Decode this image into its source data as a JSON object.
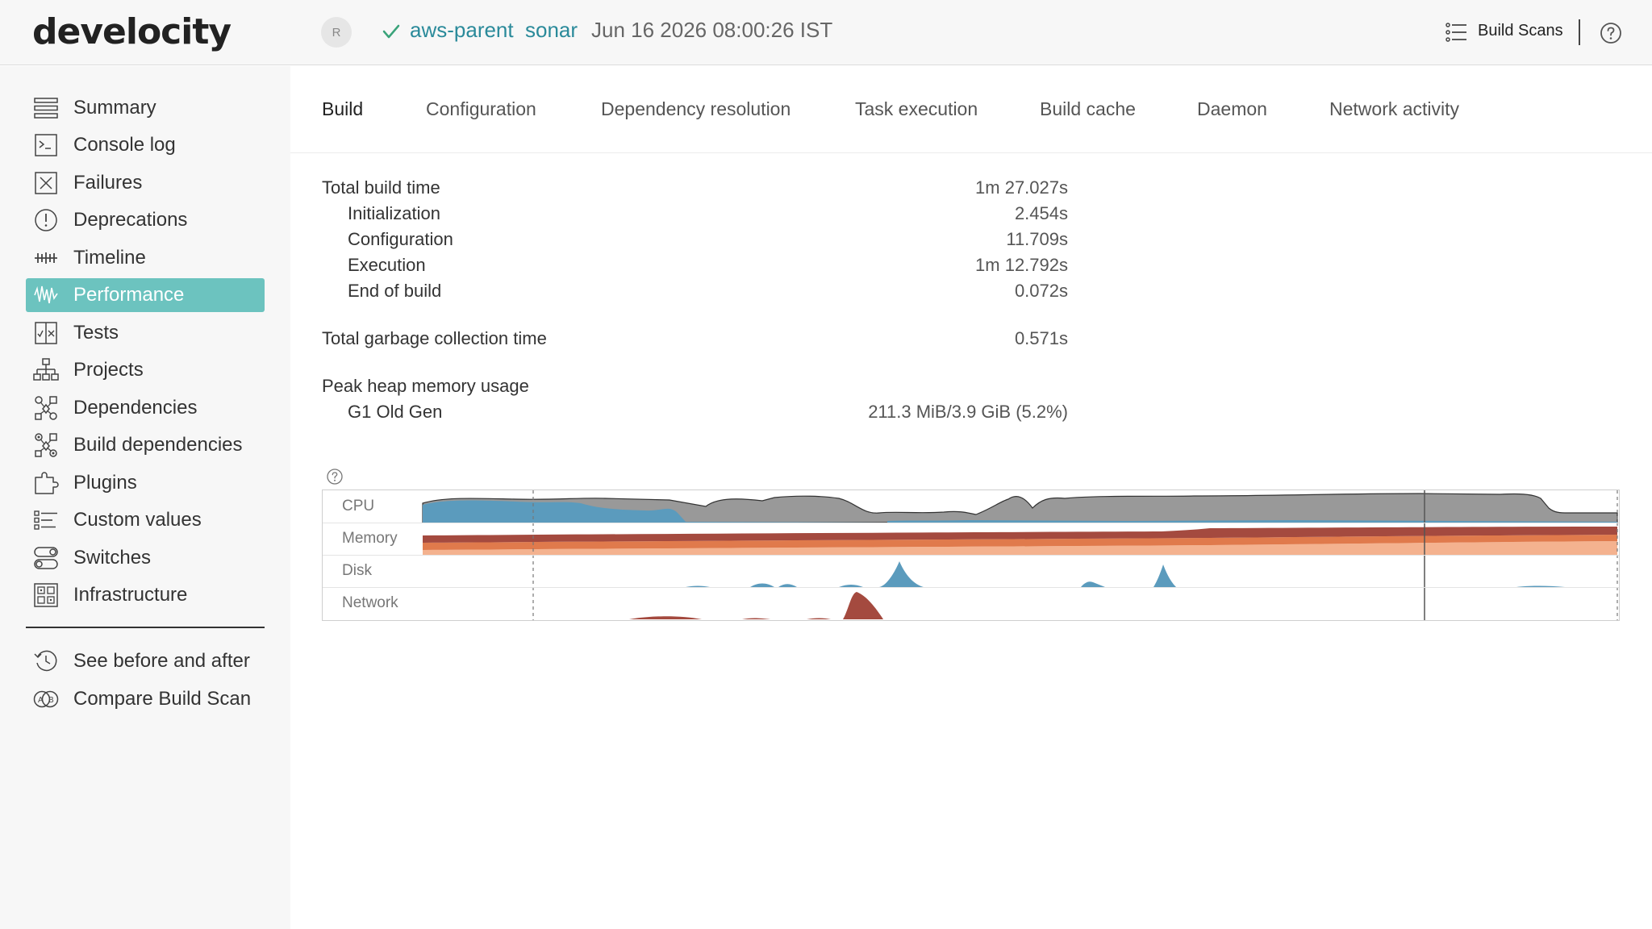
{
  "header": {
    "logo": "develocity",
    "avatar_initial": "R",
    "project": "aws-parent",
    "task": "sonar",
    "build_date": "Jun 16 2026 08:00:26 IST",
    "build_scans_label": "Build Scans"
  },
  "sidebar": {
    "items": [
      {
        "label": "Summary",
        "icon": "list-icon"
      },
      {
        "label": "Console log",
        "icon": "console-icon"
      },
      {
        "label": "Failures",
        "icon": "x-box-icon"
      },
      {
        "label": "Deprecations",
        "icon": "alert-circle-icon"
      },
      {
        "label": "Timeline",
        "icon": "timeline-icon"
      },
      {
        "label": "Performance",
        "icon": "waveform-icon"
      },
      {
        "label": "Tests",
        "icon": "tests-icon"
      },
      {
        "label": "Projects",
        "icon": "hierarchy-icon"
      },
      {
        "label": "Dependencies",
        "icon": "dependencies-icon"
      },
      {
        "label": "Build dependencies",
        "icon": "build-dependencies-icon"
      },
      {
        "label": "Plugins",
        "icon": "plugin-icon"
      },
      {
        "label": "Custom values",
        "icon": "custom-values-icon"
      },
      {
        "label": "Switches",
        "icon": "switches-icon"
      },
      {
        "label": "Infrastructure",
        "icon": "infrastructure-icon"
      }
    ],
    "active": "Performance",
    "secondary": [
      {
        "label": "See before and after",
        "icon": "history-icon"
      },
      {
        "label": "Compare Build Scan",
        "icon": "compare-icon"
      }
    ]
  },
  "tabs": [
    {
      "label": "Build"
    },
    {
      "label": "Configuration"
    },
    {
      "label": "Dependency resolution"
    },
    {
      "label": "Task execution"
    },
    {
      "label": "Build cache"
    },
    {
      "label": "Daemon"
    },
    {
      "label": "Network activity"
    }
  ],
  "active_tab": "Build",
  "metrics": {
    "total_build_time": {
      "label": "Total build time",
      "value": "1m 27.027s"
    },
    "initialization": {
      "label": "Initialization",
      "value": "2.454s"
    },
    "configuration": {
      "label": "Configuration",
      "value": "11.709s"
    },
    "execution": {
      "label": "Execution",
      "value": "1m 12.792s"
    },
    "end_of_build": {
      "label": "End of build",
      "value": "0.072s"
    },
    "gc_time": {
      "label": "Total garbage collection time",
      "value": "0.571s"
    },
    "peak_heap": {
      "label": "Peak heap memory usage"
    },
    "g1_old_gen": {
      "label": "G1 Old Gen",
      "value": "211.3 MiB/3.9 GiB (5.2%)"
    }
  },
  "resource_graph": {
    "rows": [
      "CPU",
      "Memory",
      "Disk",
      "Network"
    ],
    "colors": {
      "cpu_build": "#5b9bbd",
      "cpu_total": "#999999",
      "memory_dark": "#a44a3f",
      "memory_mid": "#e07a4c",
      "memory_light": "#f4b28f",
      "disk": "#5b9bbd",
      "network": "#a44a3f"
    }
  }
}
